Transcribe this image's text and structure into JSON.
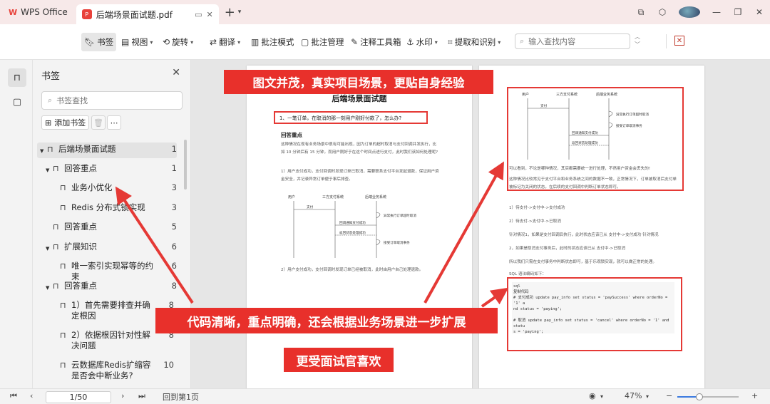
{
  "titlebar": {
    "app_name": "WPS Office",
    "doc_tab_title": "后端场景面试题.pdf"
  },
  "toolbar": {
    "items": [
      {
        "label": "书签",
        "active": true
      },
      {
        "label": "视图",
        "dropdown": true
      },
      {
        "label": "旋转",
        "dropdown": true
      },
      {
        "label": "翻译",
        "dropdown": true
      },
      {
        "label": "批注模式"
      },
      {
        "label": "批注管理"
      },
      {
        "label": "注释工具箱"
      },
      {
        "label": "水印",
        "dropdown": true
      },
      {
        "label": "提取和识别",
        "dropdown": true
      }
    ],
    "search_placeholder": "输入查找内容"
  },
  "bookmarks": {
    "title": "书签",
    "search_placeholder": "书签查找",
    "add_label": "添加书签",
    "items": [
      {
        "label": "后端场景面试题",
        "page": "1"
      },
      {
        "label": "回答重点",
        "page": "1"
      },
      {
        "label": "业务小优化",
        "page": "3"
      },
      {
        "label": "Redis 分布式锁实现",
        "page": "3"
      },
      {
        "label": "回答重点",
        "page": "5"
      },
      {
        "label": "扩展知识",
        "page": "6"
      },
      {
        "label": "唯一索引实现幂等的约束",
        "page": "6"
      },
      {
        "label": "回答重点",
        "page": "8"
      },
      {
        "label": "1）首先需要排查并确定根因",
        "page": "8"
      },
      {
        "label": "2）依据根因针对性解决问题",
        "page": "8"
      },
      {
        "label": "云数据库Redis扩缩容是否会中断业务?",
        "page": "10"
      }
    ]
  },
  "page1": {
    "title": "后端场景面试题",
    "question": "1、一笔订单，在取消的那一刻用户刚好付款了，怎么办?",
    "subheading": "回答重点",
    "para1": "这种情况在现有业务场景中很有可能出现，因为订单的超时取消与支付回调并发执行，比如 10 分钟后有 15 分钟，而用户刚好于在这个时间点进行支付，此时我们该如何处理呢?",
    "para2": "1）用户支付成功，支付回调时发现订单已取消，需要联系支付平台发起退款，保证用户资金安全，并记录异常订单便于事后排查。",
    "para3": "2）用户支付成功，支付回调时发现订单已经被取消，此时由用户自己处理退款。",
    "seq_actors": [
      "用户",
      "三方支付系统",
      "后端业务系统"
    ],
    "seq_msgs": [
      "支付",
      "回调通知支付成功",
      "返回状态处理成功",
      "异常执行订单超时取消",
      "接受订单取消事务"
    ]
  },
  "page2": {
    "seq_actors": [
      "用户",
      "三方支付系统",
      "后端业务系统"
    ],
    "seq_msgs": [
      "支付",
      "回调通知支付成功",
      "返回状态处理成功",
      "异常执行订单超时取消",
      "接受订单取消事务"
    ],
    "para1": "可以看到，不论是哪种情况，其实都需要统一进行处理，不然用户资金会丢失的!",
    "para2": "这种情况比较常见于支付平台和业务系统之间的数据不一致，正常情况下，订单被取消后支付单被标记为关闭的状态，在后续的支付回调中判断订单状态即可。",
    "line1": "1）待支付->支付中->支付成功",
    "line2": "2）待支付->支付中->已取消",
    "line3": "针对情况1，如果是支付回调后执行，此时状态应该已从 支付中->支付成功 针对情况",
    "line4": "2，如果是取消支付事务后，此时的状态应该已从 支付中->已取消",
    "line5": "所以我们只需在支付事务中判断状态即可，基于乐观锁实现，就可以做正常的处理。",
    "line6": "SQL 语法编码如下：",
    "code_lines": [
      "sql",
      "复制代码",
      "# 支付成功 update pay_info set status = 'paySuccess' where orderNo = '1' a",
      "nd status = 'paying';",
      "",
      "# 取消 update pay_info set status = 'cancel' where orderNo = '1' and statu",
      "s = 'paying';"
    ]
  },
  "annotations": {
    "banner_top": "图文并茂，真实项目场景，更贴自身经验",
    "banner_mid": "代码清晰，重点明确，还会根据业务场景进一步扩展",
    "banner_bottom": "更受面试官喜欢"
  },
  "statusbar": {
    "page_indicator": "1/50",
    "back_label": "回到第1页",
    "zoom": "47%",
    "zoom_fraction": 0.36
  },
  "colors": {
    "accent_red": "#e8302b",
    "wps_red": "#e8413a",
    "title_bg": "#f7e9e9"
  }
}
